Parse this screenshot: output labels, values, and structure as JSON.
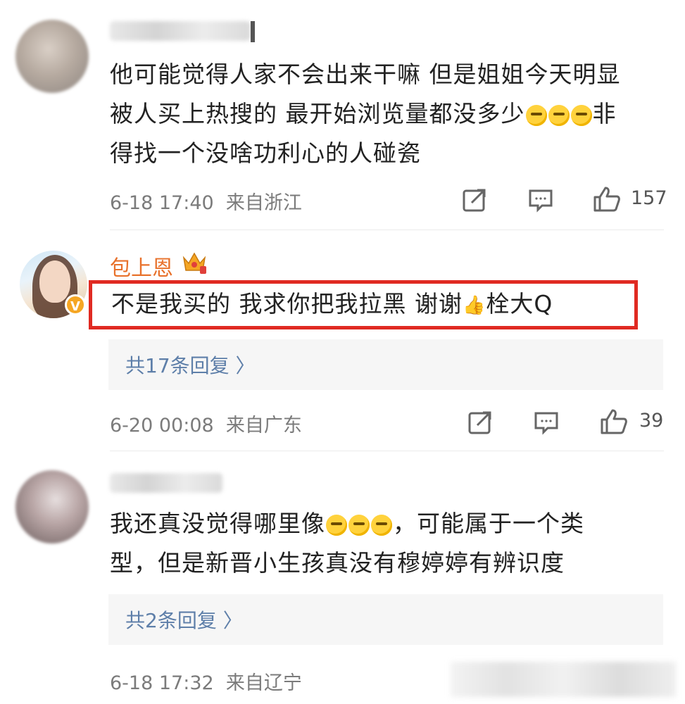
{
  "comments": [
    {
      "text_lines": [
        "他可能觉得人家不会出来干嘛 但是姐姐今天明显",
        "被人买上热搜的 最开始浏览量都没多少",
        "非",
        "得找一个没啥功利心的人碰瓷"
      ],
      "time": "6-18 17:40",
      "location": "来自浙江",
      "likes": "157"
    },
    {
      "username": "包上恩",
      "text": "不是我买的 我求你把我拉黑 谢谢",
      "text_tail": "栓大Q",
      "reply_summary": "共17条回复 〉",
      "time": "6-20 00:08",
      "location": "来自广东",
      "likes": "39"
    },
    {
      "text_lines": [
        "我还真没觉得哪里像",
        "，可能属于一个类",
        "型，但是新晋小生孩真没有穆婷婷有辨识度"
      ],
      "reply_summary": "共2条回复 〉",
      "time": "6-18 17:32",
      "location": "来自辽宁"
    }
  ],
  "icons": {
    "share": "share-icon",
    "comment": "comment-icon",
    "like": "thumbs-up-icon"
  },
  "colors": {
    "username": "#e8712b",
    "reply_link": "#5e7fa9",
    "highlight_border": "#e02a22"
  }
}
